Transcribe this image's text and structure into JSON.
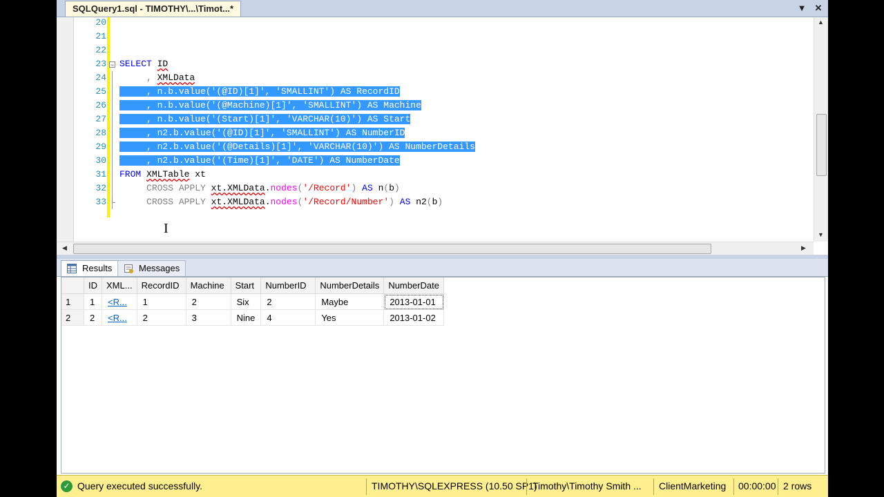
{
  "document_tab": {
    "title": "SQLQuery1.sql - TIMOTHY\\...\\Timot...*"
  },
  "editor": {
    "lines": [
      {
        "num": "20",
        "text": ""
      },
      {
        "num": "21",
        "text": ""
      },
      {
        "num": "22",
        "text": ""
      },
      {
        "num": "23",
        "text": "SELECT ID"
      },
      {
        "num": "24",
        "text": "     , XMLData"
      },
      {
        "num": "25",
        "text": "     , n.b.value('(@ID)[1]', 'SMALLINT') AS RecordID"
      },
      {
        "num": "26",
        "text": "     , n.b.value('(@Machine)[1]', 'SMALLINT') AS Machine"
      },
      {
        "num": "27",
        "text": "     , n.b.value('(Start)[1]', 'VARCHAR(10)') AS Start"
      },
      {
        "num": "28",
        "text": "     , n2.b.value('(@ID)[1]', 'SMALLINT') AS NumberID"
      },
      {
        "num": "29",
        "text": "     , n2.b.value('(@Details)[1]', 'VARCHAR(10)') AS NumberDetails"
      },
      {
        "num": "30",
        "text": "     , n2.b.value('(Time)[1]', 'DATE') AS NumberDate"
      },
      {
        "num": "31",
        "text": "FROM XMLTable xt"
      },
      {
        "num": "32",
        "text": "     CROSS APPLY xt.XMLData.nodes('/Record') AS n(b)"
      },
      {
        "num": "33",
        "text": "     CROSS APPLY xt.XMLData.nodes('/Record/Number') AS n2(b)"
      }
    ]
  },
  "results_tabs": {
    "results": "Results",
    "messages": "Messages"
  },
  "grid": {
    "columns": [
      "ID",
      "XML...",
      "RecordID",
      "Machine",
      "Start",
      "NumberID",
      "NumberDetails",
      "NumberDate"
    ],
    "rows": [
      {
        "num": "1",
        "id": "1",
        "xml": "<R...",
        "record_id": "1",
        "machine": "2",
        "start": "Six",
        "number_id": "2",
        "number_details": "Maybe",
        "number_date": "2013-01-01"
      },
      {
        "num": "2",
        "id": "2",
        "xml": "<R...",
        "record_id": "2",
        "machine": "3",
        "start": "Nine",
        "number_id": "4",
        "number_details": "Yes",
        "number_date": "2013-01-02"
      }
    ]
  },
  "status": {
    "message": "Query executed successfully.",
    "server": "TIMOTHY\\SQLEXPRESS (10.50 SP1)",
    "user": "Timothy\\Timothy Smith ...",
    "database": "ClientMarketing",
    "elapsed": "00:00:00",
    "rows": "2 rows"
  },
  "colors": {
    "selection": "#3399ff",
    "keyword": "#0000ff",
    "string": "#ff0000",
    "status_bar": "#ffef8f"
  }
}
